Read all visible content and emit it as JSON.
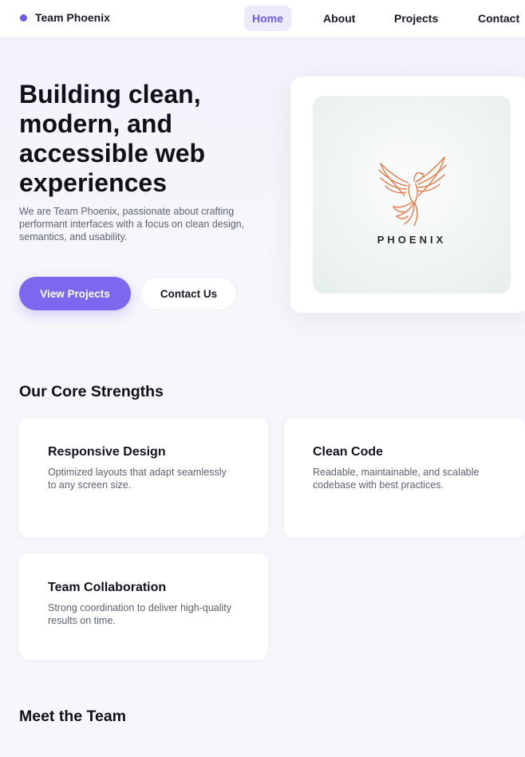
{
  "nav": {
    "brand": "Team Phoenix",
    "links": [
      "Home",
      "About",
      "Projects",
      "Contact"
    ],
    "active": "Home"
  },
  "hero": {
    "title": "Building clean, modern, and accessible web experiences",
    "text": "We are Team Phoenix, passionate about crafting performant interfaces with a focus on clean design, semantics, and usability.",
    "primary_button": "View Projects",
    "secondary_button": "Contact Us",
    "logo_word": "PHOENIX"
  },
  "strengths": {
    "heading": "Our Core Strengths",
    "cards": [
      {
        "title": "Responsive Design",
        "text": "Optimized layouts that adapt seamlessly to any screen size."
      },
      {
        "title": "Clean Code",
        "text": "Readable, maintainable, and scalable codebase with best practices."
      },
      {
        "title": "Team Collaboration",
        "text": "Strong coordination to deliver high-quality results on time."
      }
    ]
  },
  "team": {
    "heading": "Meet the Team"
  },
  "colors": {
    "accent": "#7b68ee",
    "brand_dot": "#6c5ce7",
    "logo_orange": "#e07a4a"
  }
}
